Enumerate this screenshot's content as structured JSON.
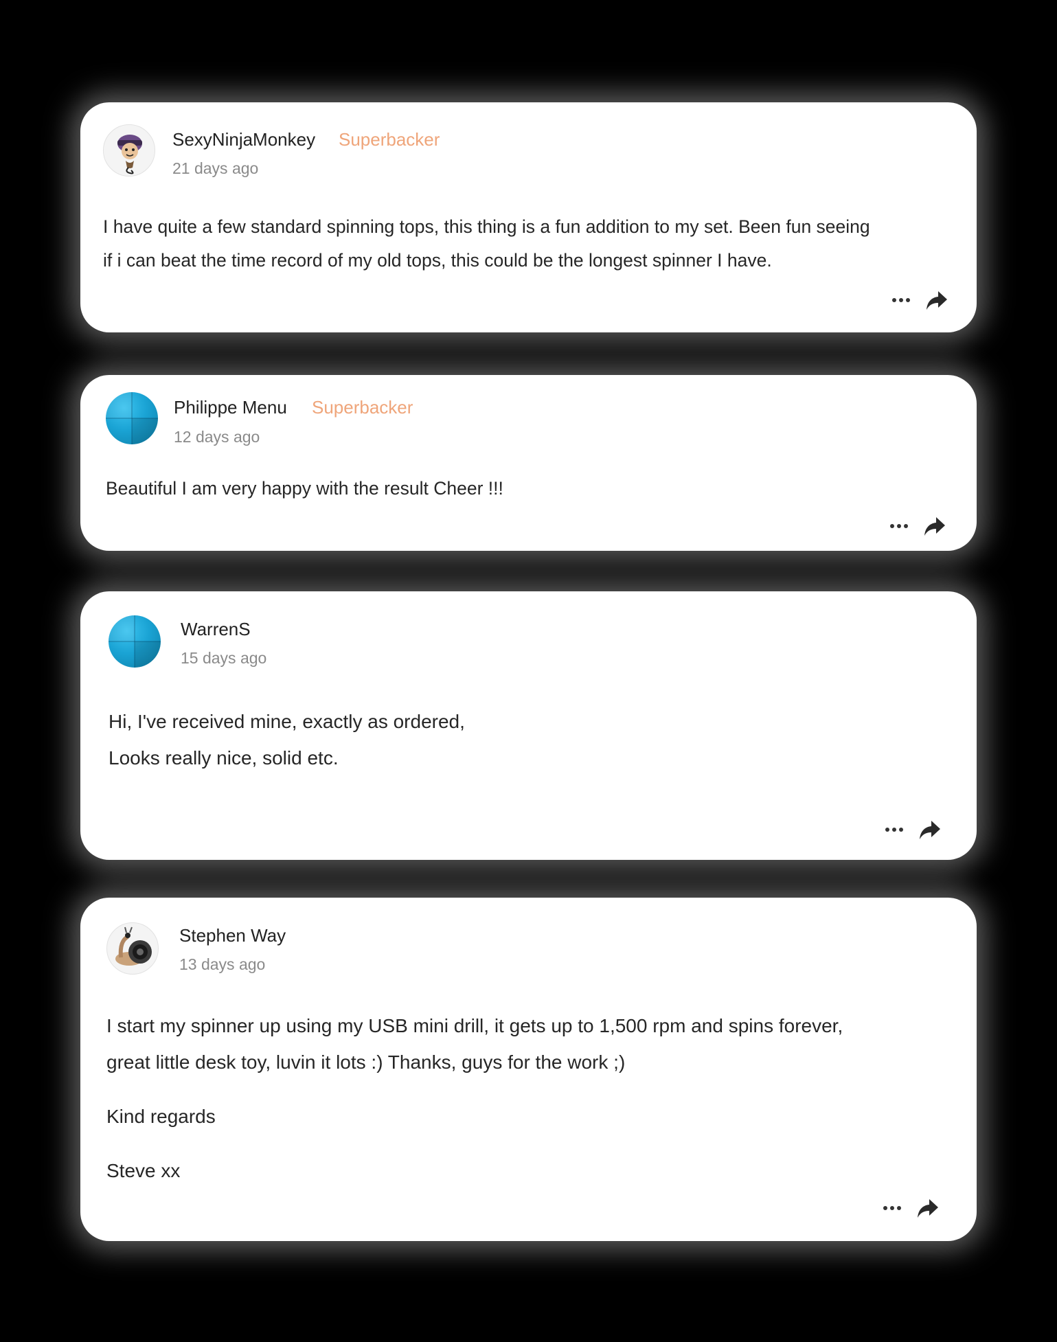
{
  "comments": [
    {
      "author": "SexyNinjaMonkey",
      "badge": "Superbacker",
      "time": "21 days ago",
      "avatar": "ninja-monkey-avatar",
      "paragraphs": [
        "I have quite a few standard spinning tops, this thing is a fun addition to my set. Been fun seeing",
        "if i can beat the time record of my old tops, this could be the longest spinner I have."
      ]
    },
    {
      "author": "Philippe Menu",
      "badge": "Superbacker",
      "time": "12 days ago",
      "avatar": "default-blue-avatar",
      "paragraphs": [
        "Beautiful I am very happy with the result Cheer !!!"
      ]
    },
    {
      "author": "WarrenS",
      "time": "15 days ago",
      "avatar": "default-blue-avatar",
      "paragraphs": [
        "Hi, I've received mine, exactly as ordered,",
        "Looks really nice, solid etc."
      ]
    },
    {
      "author": "Stephen Way",
      "time": "13 days ago",
      "avatar": "snail-avatar",
      "paragraphs": [
        "I start my spinner up using my USB mini drill, it gets up to 1,500 rpm and spins forever,",
        "great little desk toy, luvin it lots :) Thanks, guys for the work ;)",
        "Kind regards",
        "Steve xx"
      ]
    }
  ],
  "icons": {
    "more": "more-horizontal-icon",
    "share": "share-arrow-icon"
  },
  "colors": {
    "page_background": "#000000",
    "card_background": "#ffffff",
    "badge": "#efa57a",
    "author": "#222222",
    "timestamp": "#8a8a8a",
    "body_text": "#262626"
  }
}
